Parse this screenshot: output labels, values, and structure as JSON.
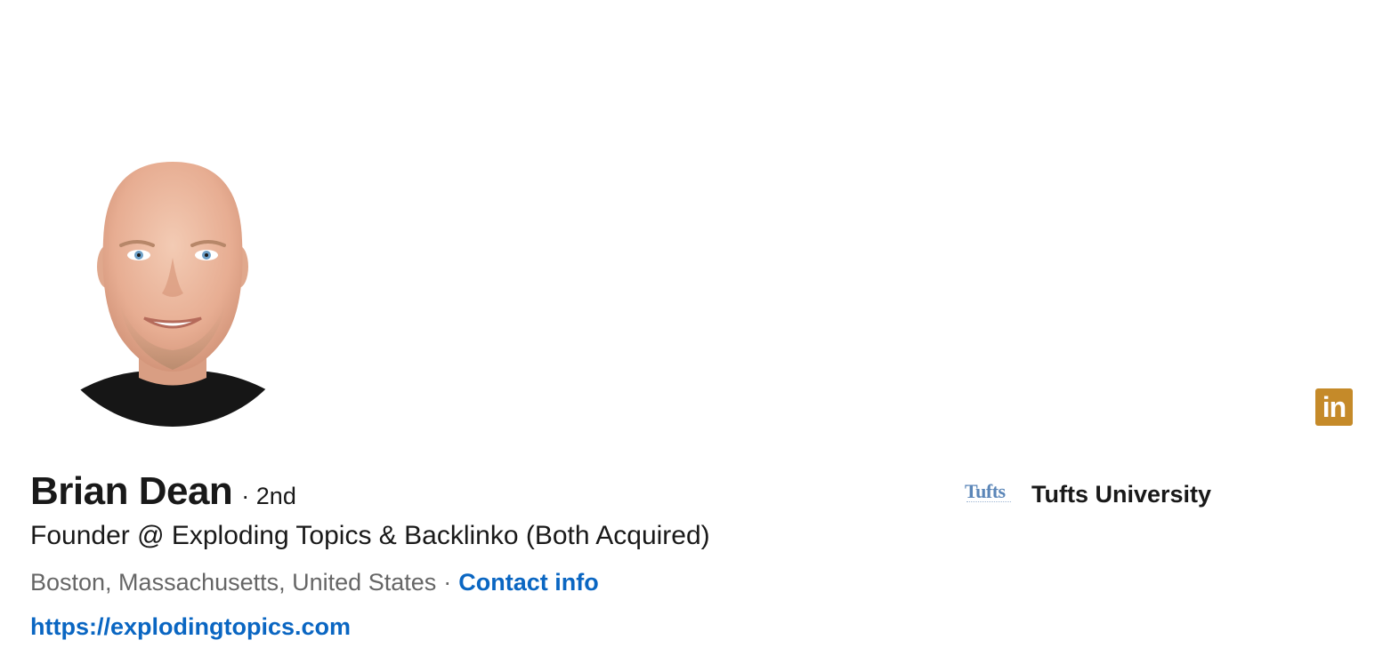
{
  "profile": {
    "name": "Brian Dean",
    "degree": "· 2nd",
    "headline": "Founder @ Exploding Topics & Backlinko (Both Acquired)",
    "location": "Boston, Massachusetts, United States",
    "separator": "·",
    "contact_label": "Contact info",
    "website": "https://explodingtopics.com"
  },
  "education": {
    "logo_text": "Tufts",
    "name": "Tufts University"
  },
  "badge": {
    "icon": "linkedin-icon",
    "text": "in",
    "color": "#c58a29"
  },
  "colors": {
    "link": "#0a66c2",
    "text": "#191919",
    "muted": "#666666"
  }
}
